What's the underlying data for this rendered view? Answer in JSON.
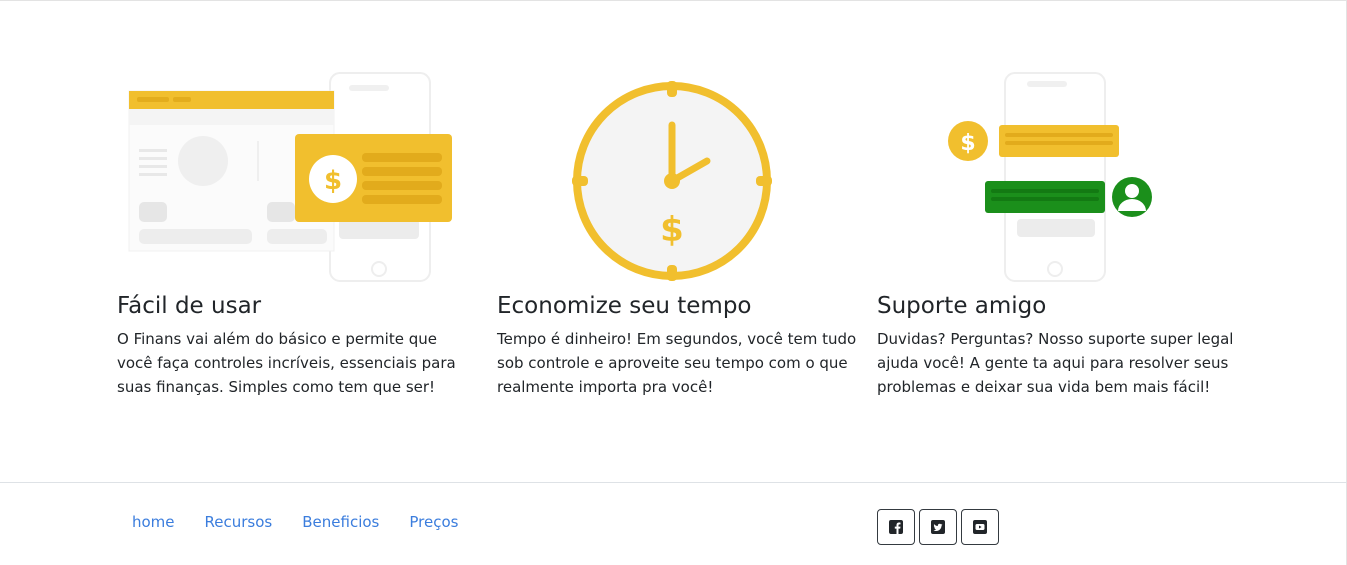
{
  "features": [
    {
      "title": "Fácil de usar",
      "text": "O Finans vai além do básico e permite que você faça controles incríveis, essenciais para suas finanças. Simples como tem que ser!"
    },
    {
      "title": "Economize seu tempo",
      "text": "Tempo é dinheiro! Em segundos, você tem tudo sob controle e aproveite seu tempo com o que realmente importa pra você!"
    },
    {
      "title": "Suporte amigo",
      "text": "Duvidas? Perguntas? Nosso suporte super legal ajuda você! A gente ta aqui para resolver seus problemas e deixar sua vida bem mais fácil!"
    }
  ],
  "footer": {
    "links": [
      "home",
      "Recursos",
      "Beneficios",
      "Preços"
    ],
    "social": [
      {
        "icon": "facebook-icon"
      },
      {
        "icon": "twitter-icon"
      },
      {
        "icon": "youtube-icon"
      }
    ]
  },
  "colors": {
    "accent_yellow": "#f1bf2e",
    "accent_green": "#1b8f1b",
    "link_blue": "#3b7ddd"
  }
}
